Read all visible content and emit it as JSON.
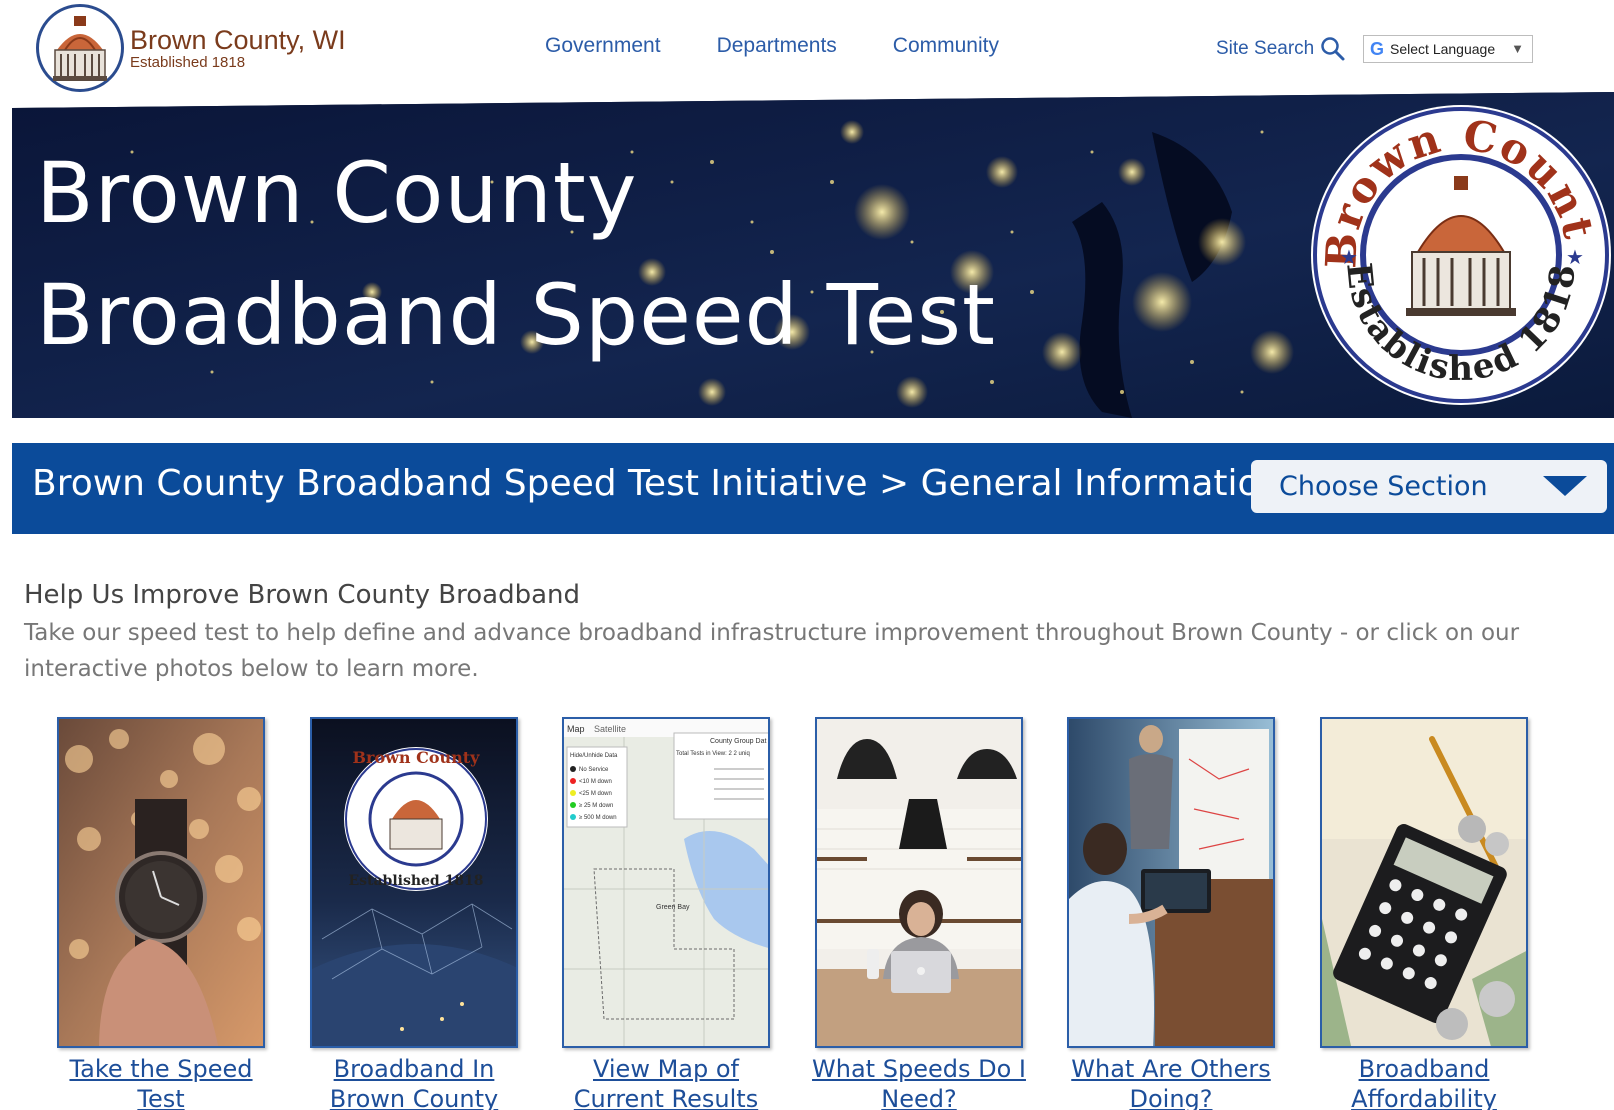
{
  "header": {
    "logo_title": "Brown County, WI",
    "logo_subtitle": "Established 1818",
    "nav": [
      "Government",
      "Departments",
      "Community"
    ],
    "site_search_label": "Site Search",
    "language_select": "Select Language"
  },
  "banner": {
    "title_line1": "Brown County",
    "title_line2": "Broadband Speed Test",
    "seal_top": "Brown County",
    "seal_bottom": "Established 1818"
  },
  "section_bar": {
    "title": "Brown County Broadband Speed Test Initiative > General Information",
    "choose_label": "Choose Section"
  },
  "intro": {
    "heading": "Help Us Improve Brown County Broadband",
    "body": "Take our speed test to help define and advance broadband infrastructure improvement throughout Brown County - or click on our interactive photos below to learn more."
  },
  "cards": [
    {
      "line1": "Take the Speed",
      "line2": "Test"
    },
    {
      "line1": "Broadband In",
      "line2": "Brown County"
    },
    {
      "line1": "View Map of",
      "line2": "Current Results"
    },
    {
      "line1": "What Speeds Do I",
      "line2": "Need?"
    },
    {
      "line1": "What Are Others",
      "line2": "Doing?"
    },
    {
      "line1": "Broadband",
      "line2": "Affordability"
    }
  ],
  "map_card": {
    "tabs": [
      "Map",
      "Satellite"
    ],
    "legend_title": "Hide/Unhide Data",
    "legend": [
      "No Service",
      "<10 M down",
      "<25 M down",
      "≥ 25 M down",
      "≥ 500 M down"
    ],
    "info_title": "County Group Dat",
    "info_line": "Total Tests in View: 2  2 uniq",
    "city": "Green Bay"
  },
  "colors": {
    "nav_blue": "#2c5ca8",
    "section_bar": "#0b4b9a",
    "brand_brown": "#7a3b1c"
  }
}
